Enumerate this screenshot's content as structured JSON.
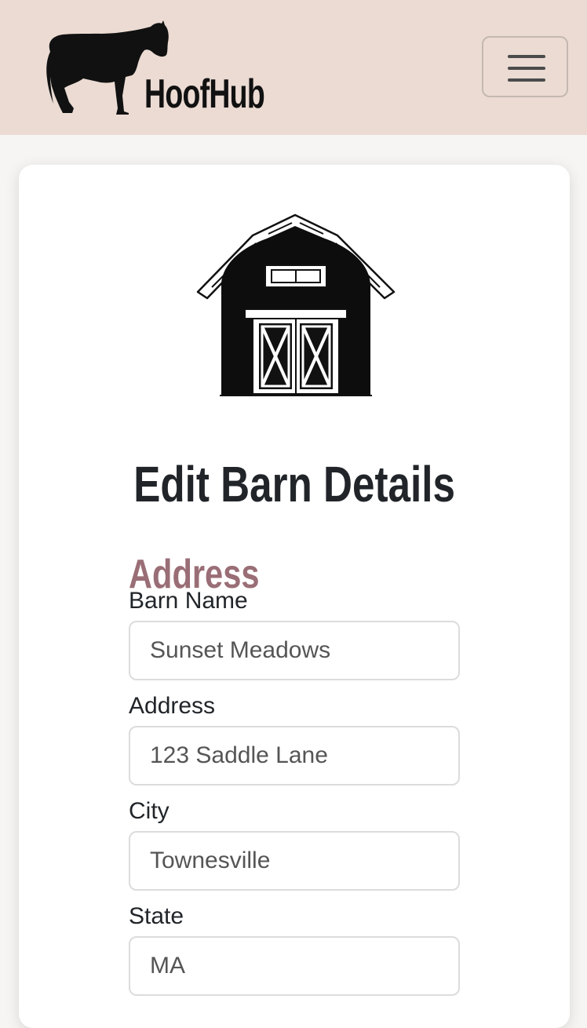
{
  "header": {
    "brand_name": "HoofHub",
    "logo_icon": "horse-silhouette-icon",
    "menu_icon": "hamburger-menu-icon"
  },
  "card": {
    "icon": "barn-icon",
    "title": "Edit Barn Details",
    "section_heading": "Address",
    "fields": [
      {
        "label": "Barn Name",
        "value": "Sunset Meadows"
      },
      {
        "label": "Address",
        "value": "123 Saddle Lane"
      },
      {
        "label": "City",
        "value": "Townesville"
      },
      {
        "label": "State",
        "value": "MA"
      }
    ]
  },
  "colors": {
    "navbar_bg": "#ebdbd3",
    "page_bg": "#f7f5f3",
    "section_heading": "#9a6e76",
    "title_text": "#212529"
  }
}
